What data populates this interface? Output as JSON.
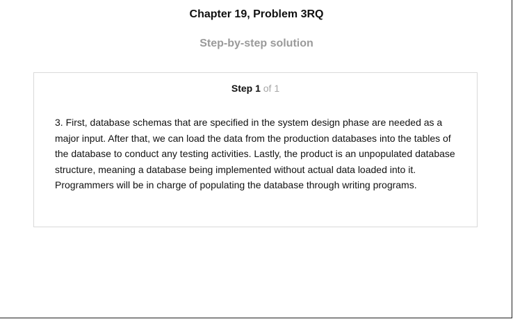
{
  "header": {
    "chapter_title": "Chapter 19, Problem 3RQ",
    "subtitle": "Step-by-step solution"
  },
  "step": {
    "label": "Step 1",
    "of_text": "of 1",
    "body": "3. First, database schemas that are specified in the system design phase are needed as a major input. After that, we can load the data from the production databases into the tables of the database to conduct any testing activities. Lastly, the product is an unpopulated database structure, meaning a database being implemented without actual data loaded into it. Programmers will be in charge of populating the database through writing programs."
  },
  "colors": {
    "title": "#111111",
    "subtitle": "#9a9a9a",
    "card_border": "#d9d9d9",
    "step_of": "#a6a6a6"
  }
}
